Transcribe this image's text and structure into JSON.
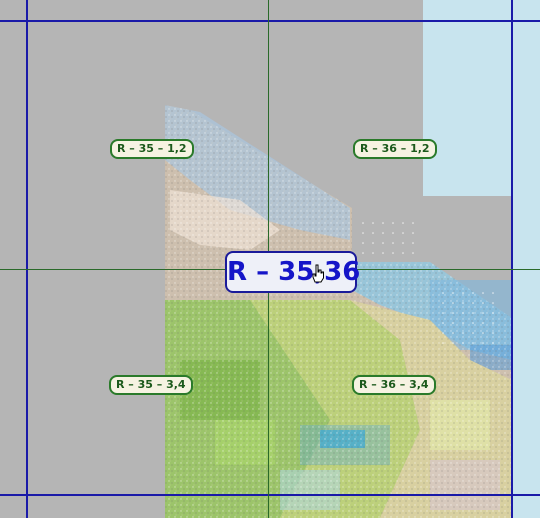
{
  "map": {
    "big_label": "R – 35,36",
    "sheets": [
      {
        "id": "r35-12",
        "label": "R – 35 – 1,2"
      },
      {
        "id": "r36-12",
        "label": "R – 36 – 1,2"
      },
      {
        "id": "r35-34",
        "label": "R – 35 – 3,4"
      },
      {
        "id": "r36-34",
        "label": "R – 36 – 3,4"
      }
    ],
    "colors": {
      "background": "#b5b5b5",
      "grid_blue": "#1a1aa8",
      "grid_green": "#2a6a2a",
      "water_light": "#c8e4ee",
      "label_green": "#2a7a2a",
      "label_blue": "#1515c8"
    },
    "cursor_icon": "hand-pointer-icon"
  }
}
